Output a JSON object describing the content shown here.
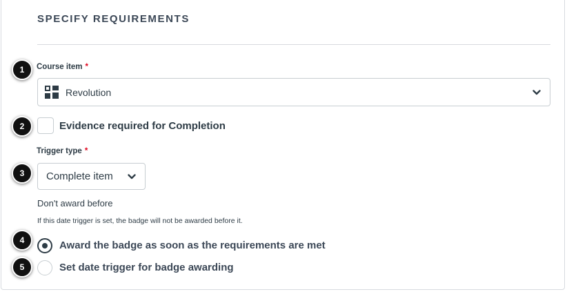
{
  "section": {
    "title": "SPECIFY REQUIREMENTS"
  },
  "course_item": {
    "label": "Course item",
    "required_mark": "*",
    "value": "Revolution",
    "icon": "module-item-icon"
  },
  "evidence": {
    "label": "Evidence required for Completion",
    "checked": false
  },
  "trigger_type": {
    "label": "Trigger type",
    "required_mark": "*",
    "value": "Complete item"
  },
  "date": {
    "label": "Don't award before",
    "helper": "If this date trigger is set, the badge will not be awarded before it."
  },
  "award_options": [
    {
      "label": "Award the badge as soon as the requirements are met",
      "selected": true
    },
    {
      "label": "Set date trigger for badge awarding",
      "selected": false
    }
  ],
  "steps": [
    "1",
    "2",
    "3",
    "4",
    "5"
  ],
  "colors": {
    "text": "#2d3b45",
    "border": "#c7cdd1",
    "required": "#e0061f",
    "step_bg": "#111111"
  }
}
